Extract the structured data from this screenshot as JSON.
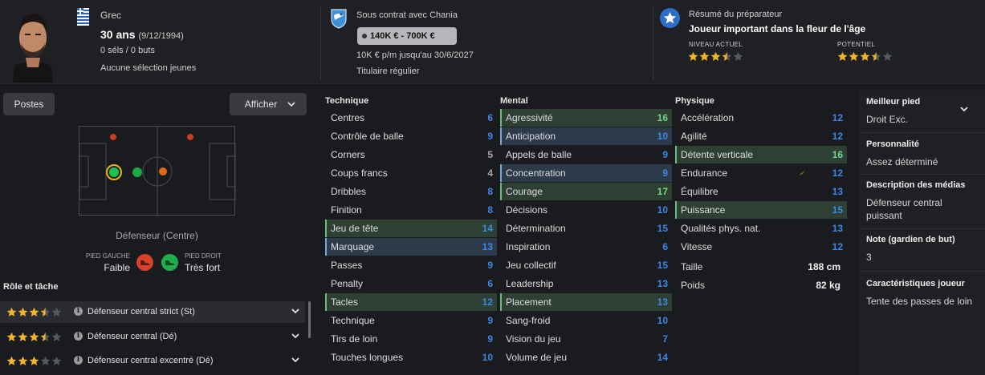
{
  "player": {
    "nationality": "Grec",
    "age": "30 ans",
    "dob": "(9/12/1994)",
    "caps": "0 séls / 0 buts",
    "youth": "Aucune sélection jeunes"
  },
  "contract": {
    "club_line": "Sous contrat avec Chania",
    "value_range": "140K € - 700K €",
    "wage": "10K € p/m jusqu'au 30/6/2027",
    "status": "Titulaire régulier"
  },
  "scout": {
    "label": "Résumé du préparateur",
    "summary": "Joueur important dans la fleur de l'âge",
    "current_label": "NIVEAU ACTUEL",
    "potential_label": "POTENTIEL",
    "current_stars": 3.5,
    "potential_stars": 3.5
  },
  "left": {
    "positions_button": "Postes",
    "show_button": "Afficher",
    "position_label": "Défenseur (Centre)",
    "left_foot_label": "PIED GAUCHE",
    "left_foot_value": "Faible",
    "right_foot_label": "PIED DROIT",
    "right_foot_value": "Très fort",
    "roles_title": "Rôle et tâche",
    "roles": [
      {
        "name": "Défenseur central strict (St)",
        "stars": 3.5
      },
      {
        "name": "Défenseur central (Dé)",
        "stars": 3.5
      },
      {
        "name": "Défenseur central excentré (Dé)",
        "stars": 3
      }
    ]
  },
  "attributes": {
    "technique_title": "Technique",
    "mental_title": "Mental",
    "physical_title": "Physique",
    "technique": [
      {
        "name": "Centres",
        "value": "6"
      },
      {
        "name": "Contrôle de balle",
        "value": "9"
      },
      {
        "name": "Corners",
        "value": "5"
      },
      {
        "name": "Coups francs",
        "value": "4"
      },
      {
        "name": "Dribbles",
        "value": "8"
      },
      {
        "name": "Finition",
        "value": "8"
      },
      {
        "name": "Jeu de tête",
        "value": "14"
      },
      {
        "name": "Marquage",
        "value": "13"
      },
      {
        "name": "Passes",
        "value": "9"
      },
      {
        "name": "Penalty",
        "value": "6"
      },
      {
        "name": "Tacles",
        "value": "12"
      },
      {
        "name": "Technique",
        "value": "9"
      },
      {
        "name": "Tirs de loin",
        "value": "9"
      },
      {
        "name": "Touches longues",
        "value": "10"
      }
    ],
    "mental": [
      {
        "name": "Agressivité",
        "value": "16"
      },
      {
        "name": "Anticipation",
        "value": "10"
      },
      {
        "name": "Appels de balle",
        "value": "9"
      },
      {
        "name": "Concentration",
        "value": "9"
      },
      {
        "name": "Courage",
        "value": "17"
      },
      {
        "name": "Décisions",
        "value": "10"
      },
      {
        "name": "Détermination",
        "value": "15"
      },
      {
        "name": "Inspiration",
        "value": "6"
      },
      {
        "name": "Jeu collectif",
        "value": "15"
      },
      {
        "name": "Leadership",
        "value": "13"
      },
      {
        "name": "Placement",
        "value": "13"
      },
      {
        "name": "Sang-froid",
        "value": "10"
      },
      {
        "name": "Vision du jeu",
        "value": "7"
      },
      {
        "name": "Volume de jeu",
        "value": "14"
      }
    ],
    "physical": [
      {
        "name": "Accélération",
        "value": "12"
      },
      {
        "name": "Agilité",
        "value": "12"
      },
      {
        "name": "Détente verticale",
        "value": "16"
      },
      {
        "name": "Endurance",
        "value": "12"
      },
      {
        "name": "Équilibre",
        "value": "13"
      },
      {
        "name": "Puissance",
        "value": "15"
      },
      {
        "name": "Qualités phys. nat.",
        "value": "13"
      },
      {
        "name": "Vitesse",
        "value": "12"
      }
    ],
    "height_label": "Taille",
    "height_value": "188 cm",
    "weight_label": "Poids",
    "weight_value": "82 kg"
  },
  "right_pane": {
    "best_foot_title": "Meilleur pied",
    "best_foot_value": "Droit Exc.",
    "personality_title": "Personnalité",
    "personality_value": "Assez déterminé",
    "media_title": "Description des médias",
    "media_value": "Défenseur central puissant",
    "gk_title": "Note (gardien de but)",
    "gk_value": "3",
    "traits_title": "Caractéristiques joueur",
    "traits_value": "Tente des passes de loin"
  },
  "colors": {
    "accent_blue": "#3b88e8",
    "accent_green": "#73d68b",
    "star_gold": "#f0b429",
    "boot_red": "#d9412b",
    "boot_green": "#1fae4b"
  }
}
